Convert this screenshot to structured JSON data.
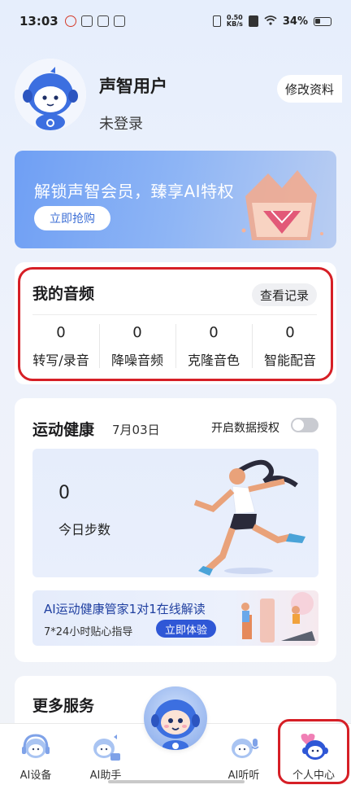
{
  "status_bar": {
    "time": "13:03",
    "speed_value": "0.50",
    "speed_unit": "KB/s",
    "battery": "34%"
  },
  "profile": {
    "username": "声智用户",
    "login_state": "未登录",
    "edit_label": "修改资料"
  },
  "vip_banner": {
    "title": "解锁声智会员，臻享AI特权",
    "button": "立即抢购"
  },
  "audio": {
    "title": "我的音频",
    "records_button": "查看记录",
    "stats": [
      {
        "value": "0",
        "label": "转写/录音"
      },
      {
        "value": "0",
        "label": "降噪音频"
      },
      {
        "value": "0",
        "label": "克隆音色"
      },
      {
        "value": "0",
        "label": "智能配音"
      }
    ]
  },
  "health": {
    "title": "运动健康",
    "date": "7月03日",
    "auth_label": "开启数据授权",
    "auth_enabled": false,
    "steps_value": "0",
    "steps_label": "今日步数",
    "coach_title": "AI运动健康管家1对1在线解读",
    "coach_sub": "7*24小时贴心指导",
    "coach_button": "立即体验"
  },
  "more": {
    "title": "更多服务"
  },
  "tabbar": {
    "tabs": [
      {
        "label": "AI设备",
        "icon": "headphone-mascot-icon"
      },
      {
        "label": "AI助手",
        "icon": "assistant-mascot-icon"
      },
      {
        "label": "",
        "icon": "center-mascot-icon"
      },
      {
        "label": "AI听听",
        "icon": "listen-mascot-icon"
      },
      {
        "label": "个人中心",
        "icon": "profile-mascot-icon"
      }
    ],
    "active": "个人中心"
  },
  "colors": {
    "accent": "#2f57d6",
    "highlight_box": "#d61f26",
    "banner_start": "#6f9ff4",
    "mascot_blue": "#3c6fe0"
  }
}
